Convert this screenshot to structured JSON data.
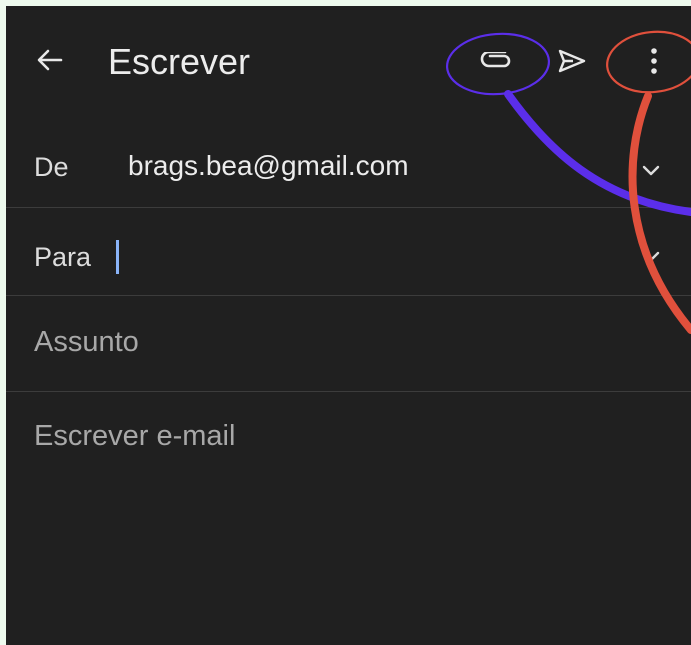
{
  "appbar": {
    "title": "Escrever",
    "icons": {
      "back": "arrow-left-icon",
      "attach": "paperclip-icon",
      "send": "send-icon",
      "more": "more-vert-icon"
    }
  },
  "compose": {
    "from_label": "De",
    "from_value": "brags.bea@gmail.com",
    "to_label": "Para",
    "to_value": "",
    "subject_placeholder": "Assunto",
    "body_placeholder": "Escrever e-mail"
  },
  "colors": {
    "background": "#202020",
    "accent_caret": "#8ab4f8",
    "annotation_purple": "#5b2eea",
    "annotation_red": "#e0503c"
  }
}
